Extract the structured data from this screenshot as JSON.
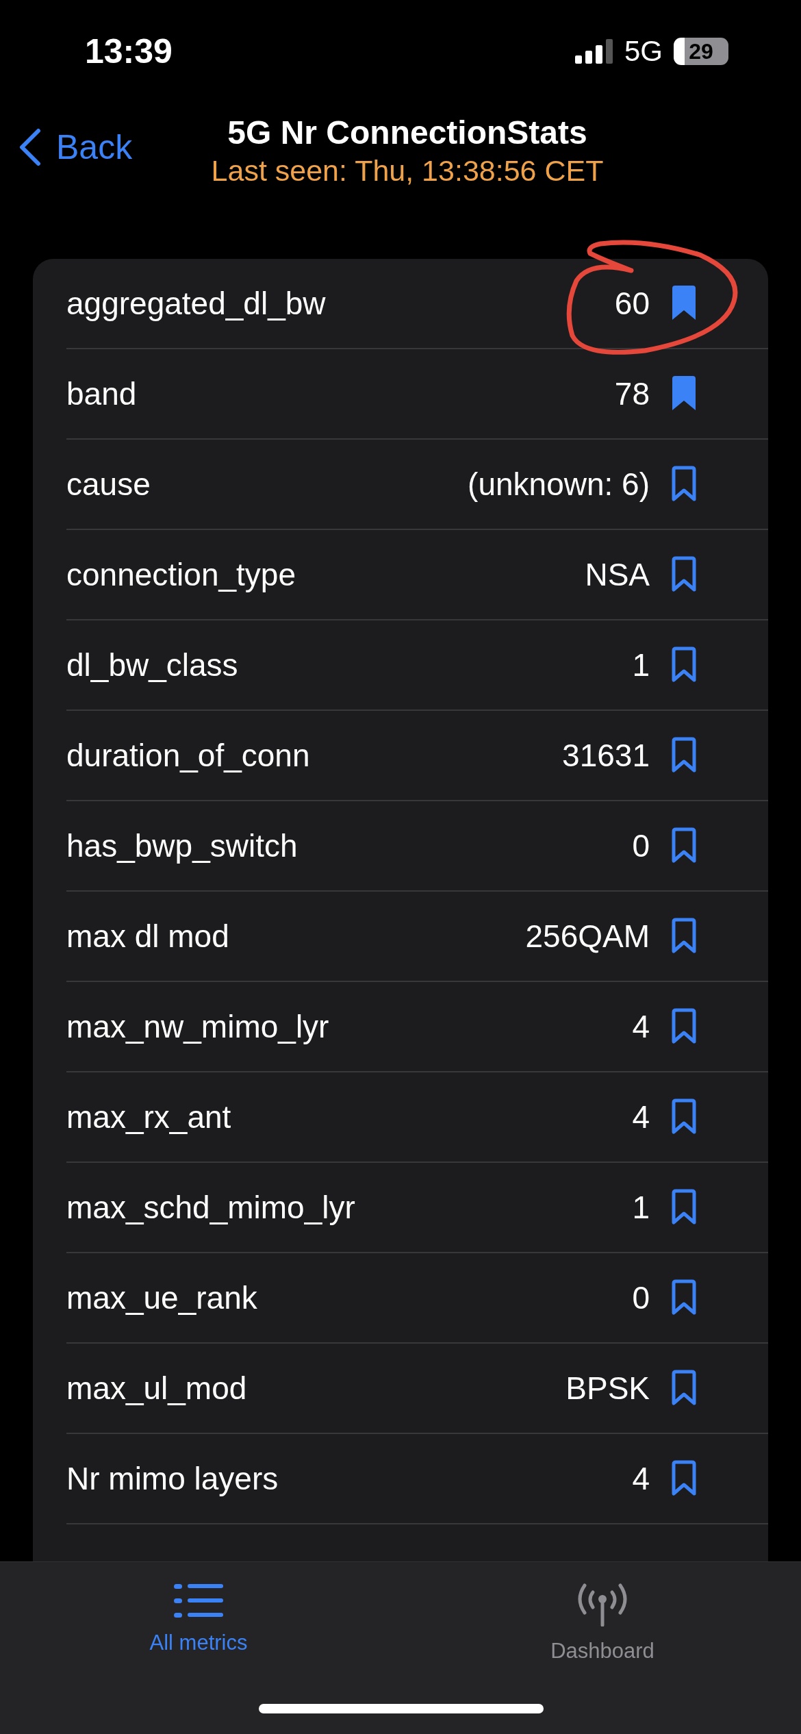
{
  "status_bar": {
    "time": "13:39",
    "network": "5G",
    "battery": "29"
  },
  "nav": {
    "back": "Back",
    "title": "5G Nr ConnectionStats",
    "subtitle": "Last seen: Thu, 13:38:56 CET"
  },
  "metrics": [
    {
      "name": "aggregated_dl_bw",
      "value": "60",
      "bookmarked": true,
      "annotated": true
    },
    {
      "name": "band",
      "value": "78",
      "bookmarked": true,
      "annotated": false
    },
    {
      "name": "cause",
      "value": "(unknown: 6)",
      "bookmarked": false,
      "annotated": false
    },
    {
      "name": "connection_type",
      "value": "NSA",
      "bookmarked": false,
      "annotated": false
    },
    {
      "name": "dl_bw_class",
      "value": "1",
      "bookmarked": false,
      "annotated": false
    },
    {
      "name": "duration_of_conn",
      "value": "31631",
      "bookmarked": false,
      "annotated": false
    },
    {
      "name": "has_bwp_switch",
      "value": "0",
      "bookmarked": false,
      "annotated": false
    },
    {
      "name": "max dl mod",
      "value": "256QAM",
      "bookmarked": false,
      "annotated": false
    },
    {
      "name": "max_nw_mimo_lyr",
      "value": "4",
      "bookmarked": false,
      "annotated": false
    },
    {
      "name": "max_rx_ant",
      "value": "4",
      "bookmarked": false,
      "annotated": false
    },
    {
      "name": "max_schd_mimo_lyr",
      "value": "1",
      "bookmarked": false,
      "annotated": false
    },
    {
      "name": "max_ue_rank",
      "value": "0",
      "bookmarked": false,
      "annotated": false
    },
    {
      "name": "max_ul_mod",
      "value": "BPSK",
      "bookmarked": false,
      "annotated": false
    },
    {
      "name": "Nr mimo layers",
      "value": "4",
      "bookmarked": false,
      "annotated": false
    }
  ],
  "tabs": [
    {
      "kind": "list",
      "label": "All metrics",
      "selected": true
    },
    {
      "kind": "antenna",
      "label": "Dashboard",
      "selected": false
    }
  ]
}
